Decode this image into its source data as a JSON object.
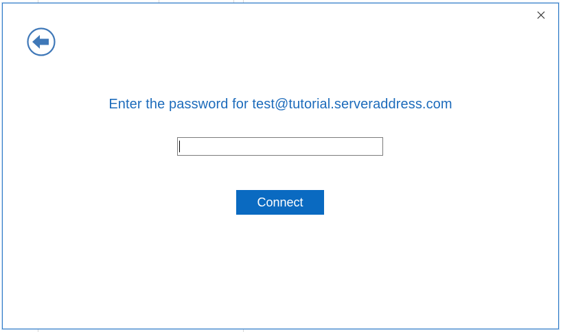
{
  "dialog": {
    "prompt": "Enter the password for test@tutorial.serveraddress.com",
    "password_value": "",
    "connect_label": "Connect",
    "close_icon": "close-icon",
    "back_icon": "back-arrow-icon",
    "accent_color": "#1c6bbb",
    "button_color": "#0a6ac1"
  }
}
